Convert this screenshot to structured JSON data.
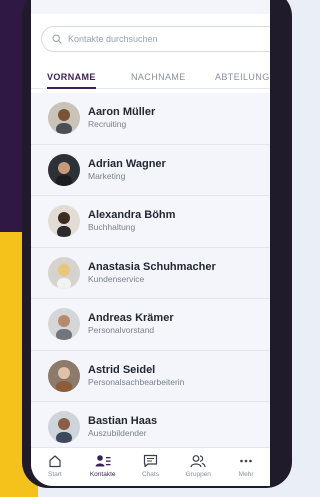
{
  "search": {
    "placeholder": "Kontakte durchsuchen"
  },
  "tabs": [
    {
      "label": "VORNAME",
      "active": true
    },
    {
      "label": "NACHNAME",
      "active": false
    },
    {
      "label": "ABTEILUNG",
      "active": false
    }
  ],
  "contacts": [
    {
      "name": "Aaron Müller",
      "role": "Recruiting"
    },
    {
      "name": "Adrian Wagner",
      "role": "Marketing"
    },
    {
      "name": "Alexandra Böhm",
      "role": "Buchhaltung"
    },
    {
      "name": "Anastasia Schuhmacher",
      "role": "Kundenservice"
    },
    {
      "name": "Andreas Krämer",
      "role": "Personalvorstand"
    },
    {
      "name": "Astrid Seidel",
      "role": "Personalsachbearbeiterin"
    },
    {
      "name": "Bastian Haas",
      "role": "Auszubildender"
    }
  ],
  "nav": [
    {
      "label": "Start",
      "icon": "home-icon"
    },
    {
      "label": "Kontakte",
      "icon": "contacts-icon",
      "active": true
    },
    {
      "label": "Chats",
      "icon": "chat-icon"
    },
    {
      "label": "Gruppen",
      "icon": "groups-icon"
    },
    {
      "label": "Mehr",
      "icon": "more-icon"
    }
  ],
  "colors": {
    "accent": "#3b1f57",
    "brand_yellow": "#f4c21b",
    "frame": "#1f1b2a"
  }
}
